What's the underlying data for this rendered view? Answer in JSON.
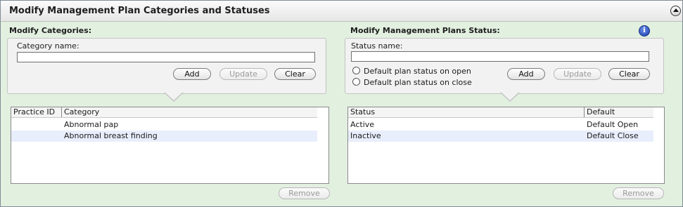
{
  "header": {
    "title": "Modify Management Plan Categories and Statuses",
    "collapse_icon": "collapse-up-icon"
  },
  "categories": {
    "section_label": "Modify Categories:",
    "field_label": "Category name:",
    "field_value": "",
    "add_label": "Add",
    "update_label": "Update",
    "clear_label": "Clear",
    "columns": [
      "Practice ID",
      "Category"
    ],
    "rows": [
      {
        "practice_id": "",
        "category": "Abnormal pap"
      },
      {
        "practice_id": "",
        "category": "Abnormal breast finding"
      }
    ],
    "remove_label": "Remove"
  },
  "statuses": {
    "section_label": "Modify Management Plans Status:",
    "info_icon": "info-icon",
    "field_label": "Status name:",
    "field_value": "",
    "radio_open_label": "Default plan status on open",
    "radio_close_label": "Default plan status on close",
    "add_label": "Add",
    "update_label": "Update",
    "clear_label": "Clear",
    "columns": [
      "Status",
      "Default"
    ],
    "rows": [
      {
        "status": "Active",
        "default": "Default Open"
      },
      {
        "status": "Inactive",
        "default": "Default Close"
      }
    ],
    "remove_label": "Remove"
  },
  "colors": {
    "background": "#e2f0e0",
    "selected_row": "#e8eefb",
    "info_blue": "#1d3fae"
  }
}
